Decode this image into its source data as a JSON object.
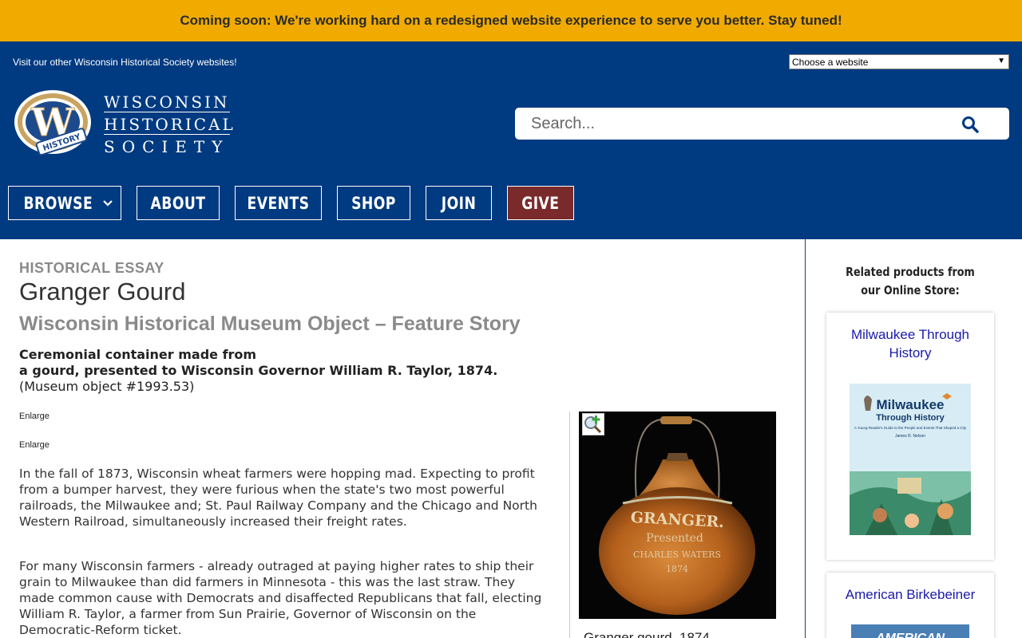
{
  "banner": {
    "text": "Coming soon: We're working hard on a redesigned website experience to serve you better. Stay tuned!"
  },
  "header": {
    "visit_text": "Visit our other Wisconsin Historical Society websites!",
    "site_select": {
      "selected": "Choose a website"
    },
    "logo": {
      "line1": "WISCONSIN",
      "line2": "HISTORICAL",
      "line3": "SOCIETY",
      "badge_letter": "W",
      "badge_ribbon": "HISTORY"
    },
    "search": {
      "placeholder": "Search..."
    },
    "nav": {
      "browse": "BROWSE",
      "about": "ABOUT",
      "events": "EVENTS",
      "shop": "SHOP",
      "join": "JOIN",
      "give": "GIVE"
    }
  },
  "main": {
    "eyebrow": "HISTORICAL ESSAY",
    "title": "Granger Gourd",
    "subtitle": "Wisconsin Historical Museum Object – Feature Story",
    "lede_line1": "Ceremonial container made from",
    "lede_line2": "a gourd, presented to Wisconsin Governor William R. Taylor, 1874.",
    "lede_line3": "(Museum object #1993.53)",
    "enlarge1": "Enlarge",
    "enlarge2": "Enlarge",
    "para1": "In the fall of 1873, Wisconsin wheat farmers were hopping mad. Expecting to profit from a bumper harvest, they were furious when the state's two most powerful railroads, the Milwaukee and; St. Paul Railway Company and the Chicago and North Western Railroad, simultaneously increased their freight rates.",
    "para2": "For many Wisconsin farmers - already outraged at paying higher rates to ship their grain to Milwaukee than did farmers in Minnesota - this was the last straw. They made common cause with Democrats and disaffected Republicans that fall, electing William R. Taylor, a farmer from Sun Prairie, Governor of Wisconsin on the Democratic-Reform ticket.",
    "figure": {
      "gourd_text1": "GRANGER.",
      "gourd_text2": "Presented",
      "gourd_text3": "CHARLES WATERS",
      "gourd_text4": "1874",
      "caption": "Granger gourd, 1874"
    }
  },
  "sidebar": {
    "title": "Related products from our Online Store:",
    "products": [
      {
        "title": "Milwaukee Through History",
        "cover_title_1": "Milwaukee",
        "cover_title_2": "Through History",
        "cover_subtitle": "A Young Reader's Guide to the People and Events That Shaped a City",
        "cover_author": "James R. Nelson"
      },
      {
        "title": "American Birkebeiner",
        "cover_title": "AMERICAN"
      }
    ]
  },
  "colors": {
    "banner": "#f0aa00",
    "header": "#003a80",
    "give_button": "#7a2a2a",
    "link": "#1a1aaa"
  }
}
